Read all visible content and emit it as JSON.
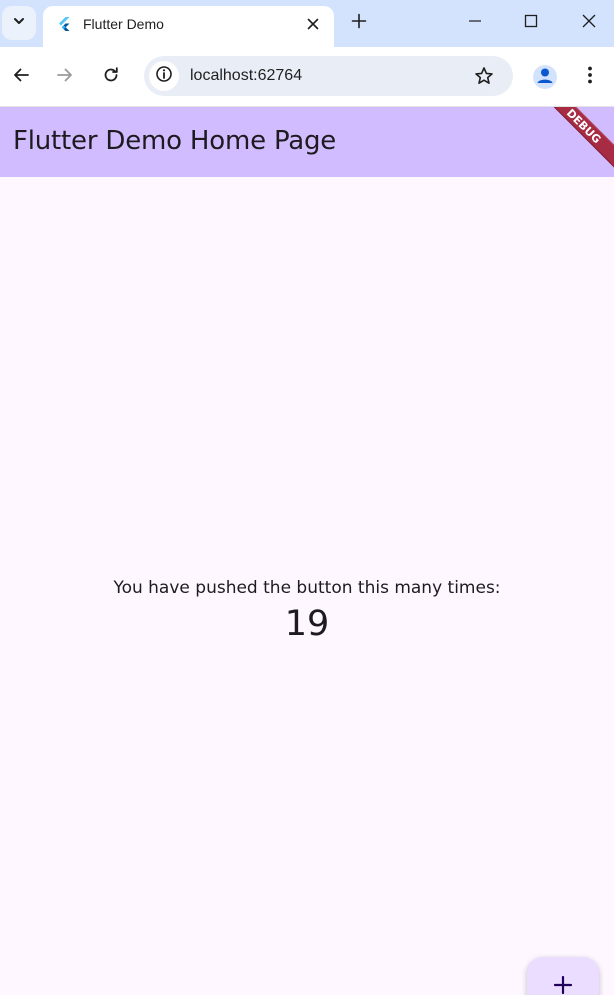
{
  "browser": {
    "tab": {
      "title": "Flutter Demo"
    },
    "address": {
      "url": "localhost:62764"
    }
  },
  "app": {
    "appbar_title": "Flutter Demo Home Page",
    "debug_banner": "DEBUG",
    "counter_label": "You have pushed the button this many times:",
    "counter_value": "19",
    "fab_icon": "add-icon"
  },
  "colors": {
    "tabstrip": "#d3e3fd",
    "appbar": "#d1bcff",
    "app_background": "#fef7ff",
    "fab": "#eaddff",
    "debug_banner": "#a62b43"
  }
}
